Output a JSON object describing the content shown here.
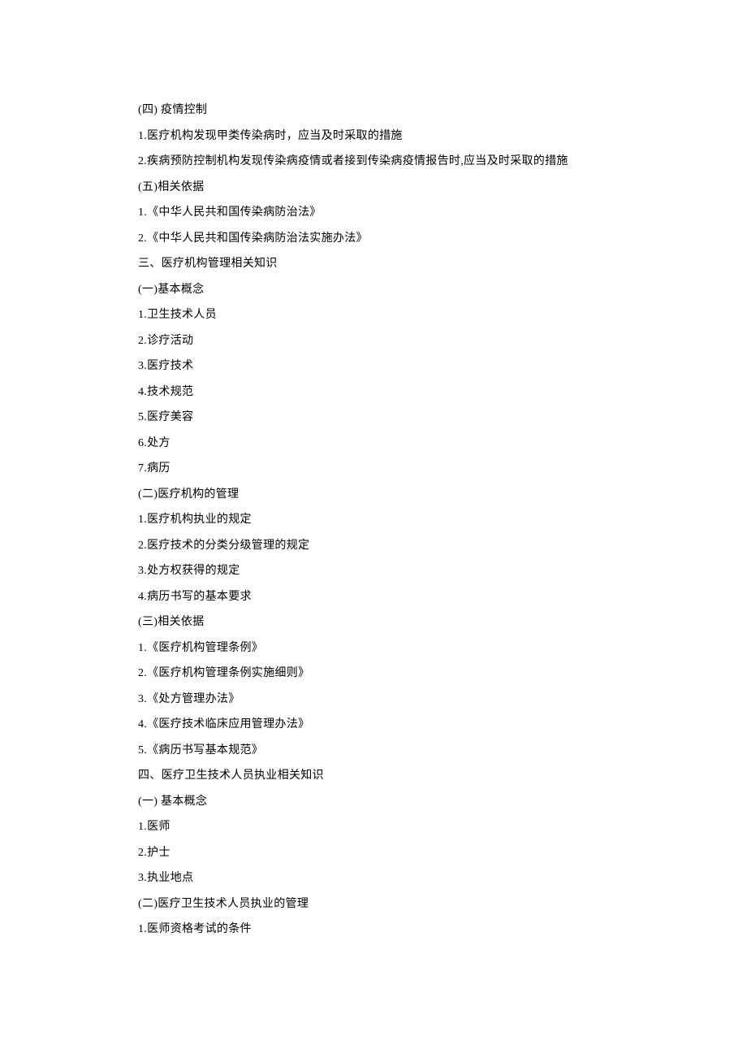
{
  "lines": [
    "(四) 疫情控制",
    "1.医疗机构发现甲类传染病时，应当及时采取的措施",
    "2.疾病预防控制机构发现传染病疫情或者接到传染病疫情报告时,应当及时采取的措施",
    "(五)相关依据",
    "1.《中华人民共和国传染病防治法》",
    "2.《中华人民共和国传染病防治法实施办法》",
    "三、医疗机构管理相关知识",
    "(一)基本概念",
    "1.卫生技术人员",
    "2.诊疗活动",
    "3.医疗技术",
    "4.技术规范",
    "5.医疗美容",
    "6.处方",
    "7.病历",
    "(二)医疗机构的管理",
    "1.医疗机构执业的规定",
    "2.医疗技术的分类分级管理的规定",
    "3.处方权获得的规定",
    "4.病历书写的基本要求",
    "(三)相关依据",
    "1.《医疗机构管理条例》",
    "2.《医疗机构管理条例实施细则》",
    "3.《处方管理办法》",
    "4.《医疗技术临床应用管理办法》",
    "5.《病历书写基本规范》",
    "四、医疗卫生技术人员执业相关知识",
    "(一) 基本概念",
    "1.医师",
    "2.护士",
    "3.执业地点",
    "(二)医疗卫生技术人员执业的管理",
    "1.医师资格考试的条件"
  ]
}
